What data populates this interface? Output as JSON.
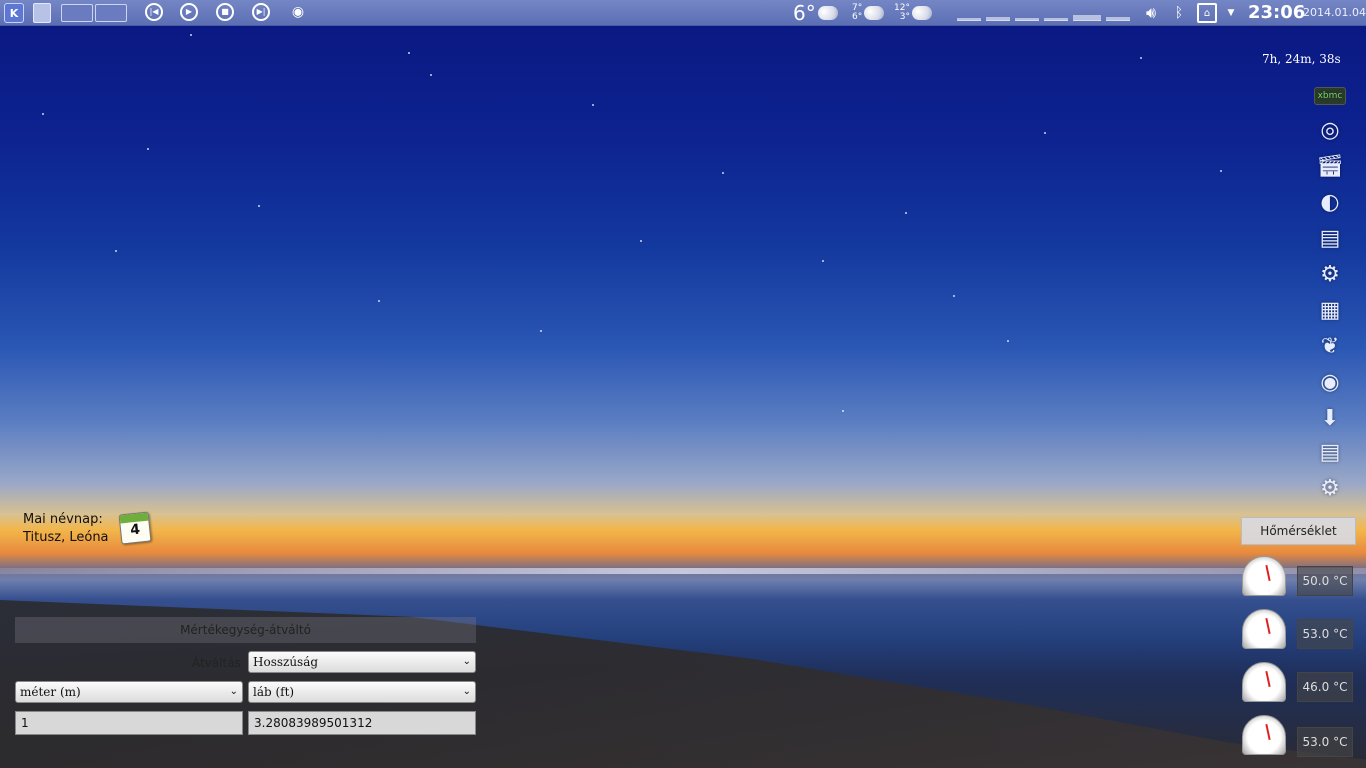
{
  "panel": {
    "launcher_label": "K",
    "media_controls": [
      "previous-icon",
      "play-icon",
      "stop-icon",
      "next-icon"
    ],
    "weather_current": "6°",
    "forecast": [
      {
        "high": "7°",
        "low": "6°"
      },
      {
        "high": "12°",
        "low": "3°"
      }
    ],
    "clock": "23:06",
    "date": "2014.01.04"
  },
  "uptime": "7h, 24m, 38s",
  "dock_items": [
    "xbmc",
    "disc-icon",
    "clapperboard-icon",
    "shark-icon",
    "drive-icon",
    "gear-icon",
    "display-icon",
    "gimp-icon",
    "eye-icon",
    "download-icon",
    "drive-icon",
    "media-gear-icon"
  ],
  "dock_xbmc_label": "xbmc",
  "nameday": {
    "label": "Mai névnap:",
    "names": "Titusz, Leóna",
    "calendar_day": "4"
  },
  "converter": {
    "title": "Mértékegység-átváltó",
    "category_label": "Átváltás",
    "category_value": "Hosszúság",
    "from_unit": "méter (m)",
    "to_unit": "láb (ft)",
    "from_value": "1",
    "to_value": "3.28083989501312"
  },
  "temperature": {
    "title": "Hőmérséklet",
    "values": [
      "50.0 °C",
      "53.0 °C",
      "46.0 °C",
      "53.0 °C"
    ]
  },
  "colors": {
    "panel": "#6677bb",
    "accent": "#f2b64a"
  }
}
